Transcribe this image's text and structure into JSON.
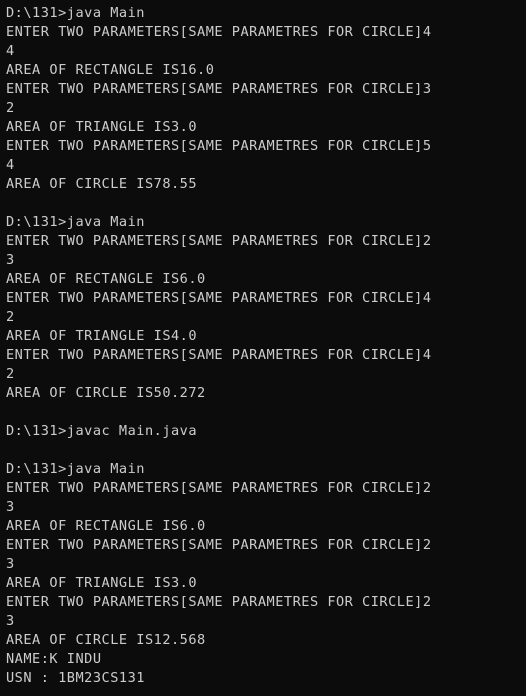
{
  "terminal": {
    "lines": [
      "D:\\131>java Main",
      "ENTER TWO PARAMETERS[SAME PARAMETRES FOR CIRCLE]4",
      "4",
      "AREA OF RECTANGLE IS16.0",
      "ENTER TWO PARAMETERS[SAME PARAMETRES FOR CIRCLE]3",
      "2",
      "AREA OF TRIANGLE IS3.0",
      "ENTER TWO PARAMETERS[SAME PARAMETRES FOR CIRCLE]5",
      "4",
      "AREA OF CIRCLE IS78.55",
      "",
      "D:\\131>java Main",
      "ENTER TWO PARAMETERS[SAME PARAMETRES FOR CIRCLE]2",
      "3",
      "AREA OF RECTANGLE IS6.0",
      "ENTER TWO PARAMETERS[SAME PARAMETRES FOR CIRCLE]4",
      "2",
      "AREA OF TRIANGLE IS4.0",
      "ENTER TWO PARAMETERS[SAME PARAMETRES FOR CIRCLE]4",
      "2",
      "AREA OF CIRCLE IS50.272",
      "",
      "D:\\131>javac Main.java",
      "",
      "D:\\131>java Main",
      "ENTER TWO PARAMETERS[SAME PARAMETRES FOR CIRCLE]2",
      "3",
      "AREA OF RECTANGLE IS6.0",
      "ENTER TWO PARAMETERS[SAME PARAMETRES FOR CIRCLE]2",
      "3",
      "AREA OF TRIANGLE IS3.0",
      "ENTER TWO PARAMETERS[SAME PARAMETRES FOR CIRCLE]2",
      "3",
      "AREA OF CIRCLE IS12.568",
      "NAME:K INDU",
      "USN : 1BM23CS131"
    ],
    "colors": {
      "background": "#0c0c0c",
      "text": "#cccccc"
    }
  }
}
